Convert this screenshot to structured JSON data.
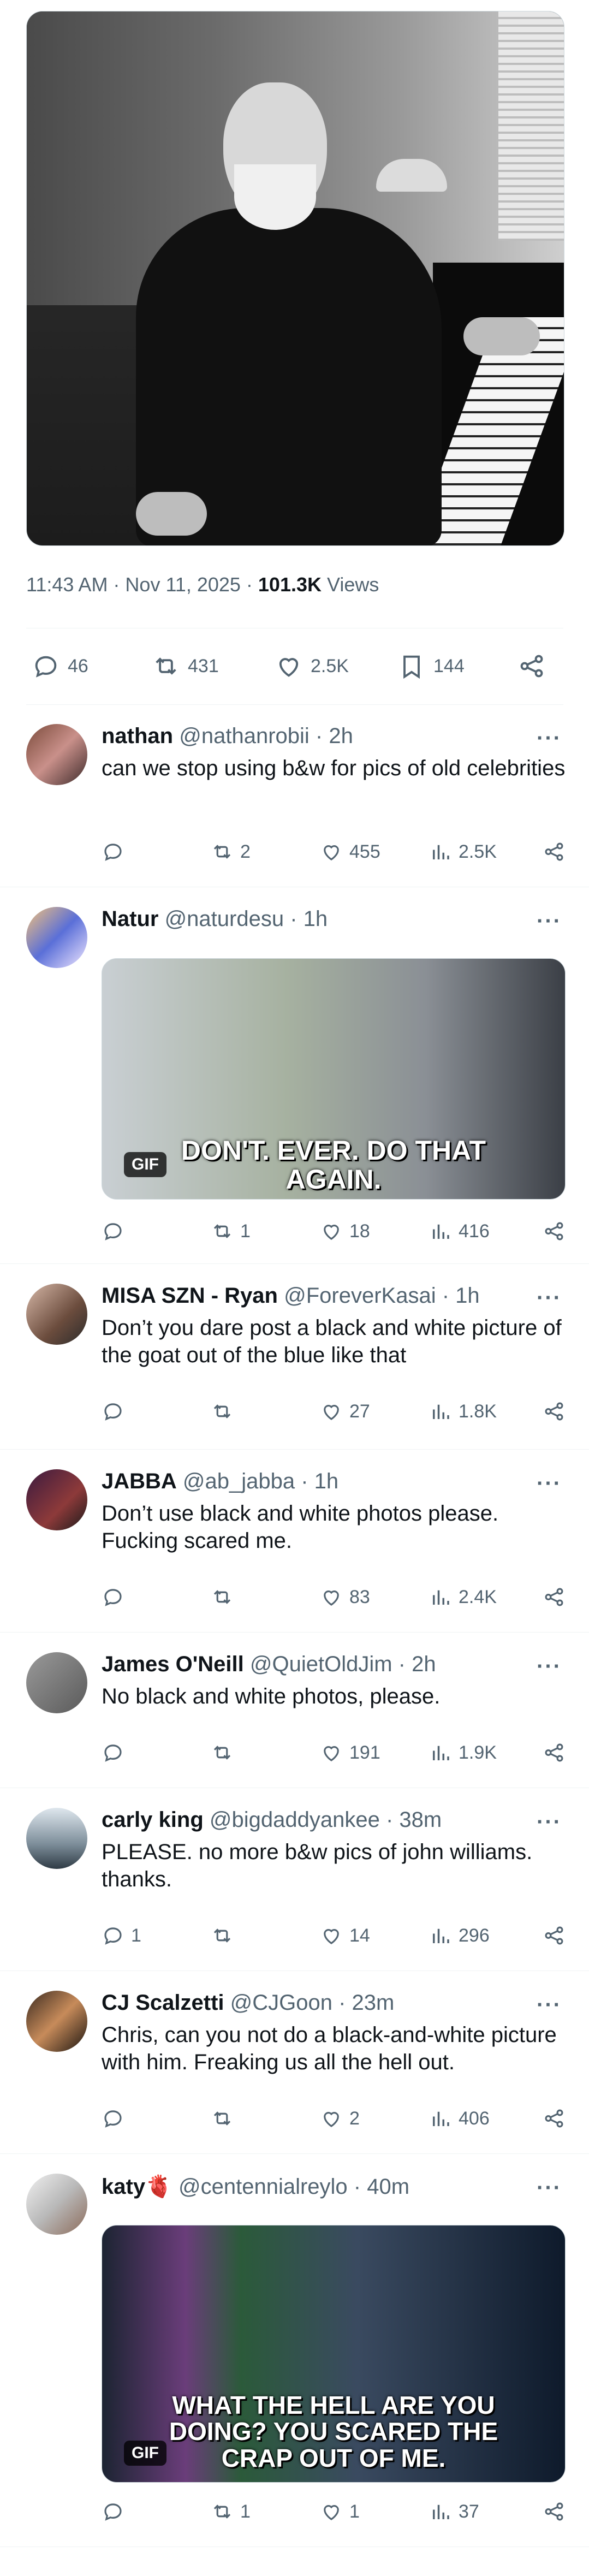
{
  "tweet": {
    "time": "11:43 AM · Nov 11, 2025 · ",
    "views_count": "101.3K",
    "views_label": " Views",
    "replies": "46",
    "reposts": "431",
    "likes": "2.5K",
    "bookmarks": "144"
  },
  "replies": [
    {
      "name": "nathan",
      "handle": "@nathanrobii · 2h",
      "text": "can we stop using b&w for pics of old celebrities",
      "replies": "",
      "reposts": "2",
      "likes": "455",
      "views": "2.5K"
    },
    {
      "name": "Natur",
      "handle": "@naturdesu · 1h",
      "text": "",
      "gif_caption": "DON'T. EVER. DO THAT AGAIN.",
      "gif_tag": "GIF",
      "replies": "",
      "reposts": "1",
      "likes": "18",
      "views": "416"
    },
    {
      "name": "MISA SZN - Ryan",
      "handle": "@ForeverKasai · 1h",
      "text": "Don’t you dare post a black and white picture of the goat out of the blue like that",
      "replies": "",
      "reposts": "",
      "likes": "27",
      "views": "1.8K"
    },
    {
      "name": "JABBA",
      "handle": "@ab_jabba · 1h",
      "text": "Don’t use black and white photos please. Fucking scared me.",
      "replies": "",
      "reposts": "",
      "likes": "83",
      "views": "2.4K"
    },
    {
      "name": "James O'Neill",
      "handle": "@QuietOldJim · 2h",
      "text": "No black and white photos, please.",
      "replies": "",
      "reposts": "",
      "likes": "191",
      "views": "1.9K"
    },
    {
      "name": "carly king",
      "handle": "@bigdaddyankee · 38m",
      "text": "PLEASE. no more b&w pics of john williams. thanks.",
      "replies": "1",
      "reposts": "",
      "likes": "14",
      "views": "296"
    },
    {
      "name": "CJ Scalzetti",
      "handle": "@CJGoon · 23m",
      "text": "Chris, can you not do a black-and-white picture with him. Freaking us all the hell out.",
      "replies": "",
      "reposts": "",
      "likes": "2",
      "views": "406"
    },
    {
      "name": "katy🫀",
      "handle": "@centennialreylo · 40m",
      "text": "",
      "gif_caption": "WHAT THE HELL ARE YOU DOING? YOU SCARED THE CRAP OUT OF ME.",
      "gif_tag": "GIF",
      "replies": "",
      "reposts": "1",
      "likes": "1",
      "views": "37"
    }
  ],
  "colors": {
    "text": "#0f1419",
    "muted": "#536471",
    "border": "#eff3f4"
  },
  "icons": [
    "comment-icon",
    "repost-icon",
    "heart-icon",
    "bookmark-icon",
    "share-icon",
    "views-icon",
    "more-icon"
  ]
}
